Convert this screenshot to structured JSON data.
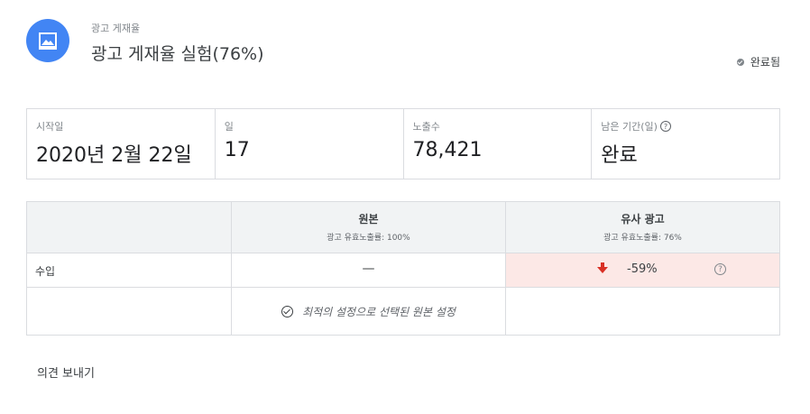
{
  "header": {
    "icon": "image-icon",
    "subtitle": "광고 게재율",
    "title": "광고 게재율 실험(76%)",
    "status": "완료됨"
  },
  "stats": {
    "start_date_label": "시작일",
    "start_date_value": "2020년 2월 22일",
    "days_label": "일",
    "days_value": "17",
    "impressions_label": "노출수",
    "impressions_value": "78,421",
    "remaining_label": "남은 기간(일)",
    "remaining_value": "완료"
  },
  "table": {
    "original_title": "원본",
    "original_sub": "광고 유효노출률: 100%",
    "variant_title": "유사 광고",
    "variant_sub": "광고 유효노출률: 76%",
    "metric_label": "수입",
    "original_value": "—",
    "variant_value": "-59%",
    "variant_trend": "down",
    "variant_color": "#fce8e6",
    "note": "최적의 설정으로 선택된 원본 설정"
  },
  "feedback_label": "의견 보내기",
  "colors": {
    "accent": "#4285f4",
    "negative": "#d93025"
  }
}
